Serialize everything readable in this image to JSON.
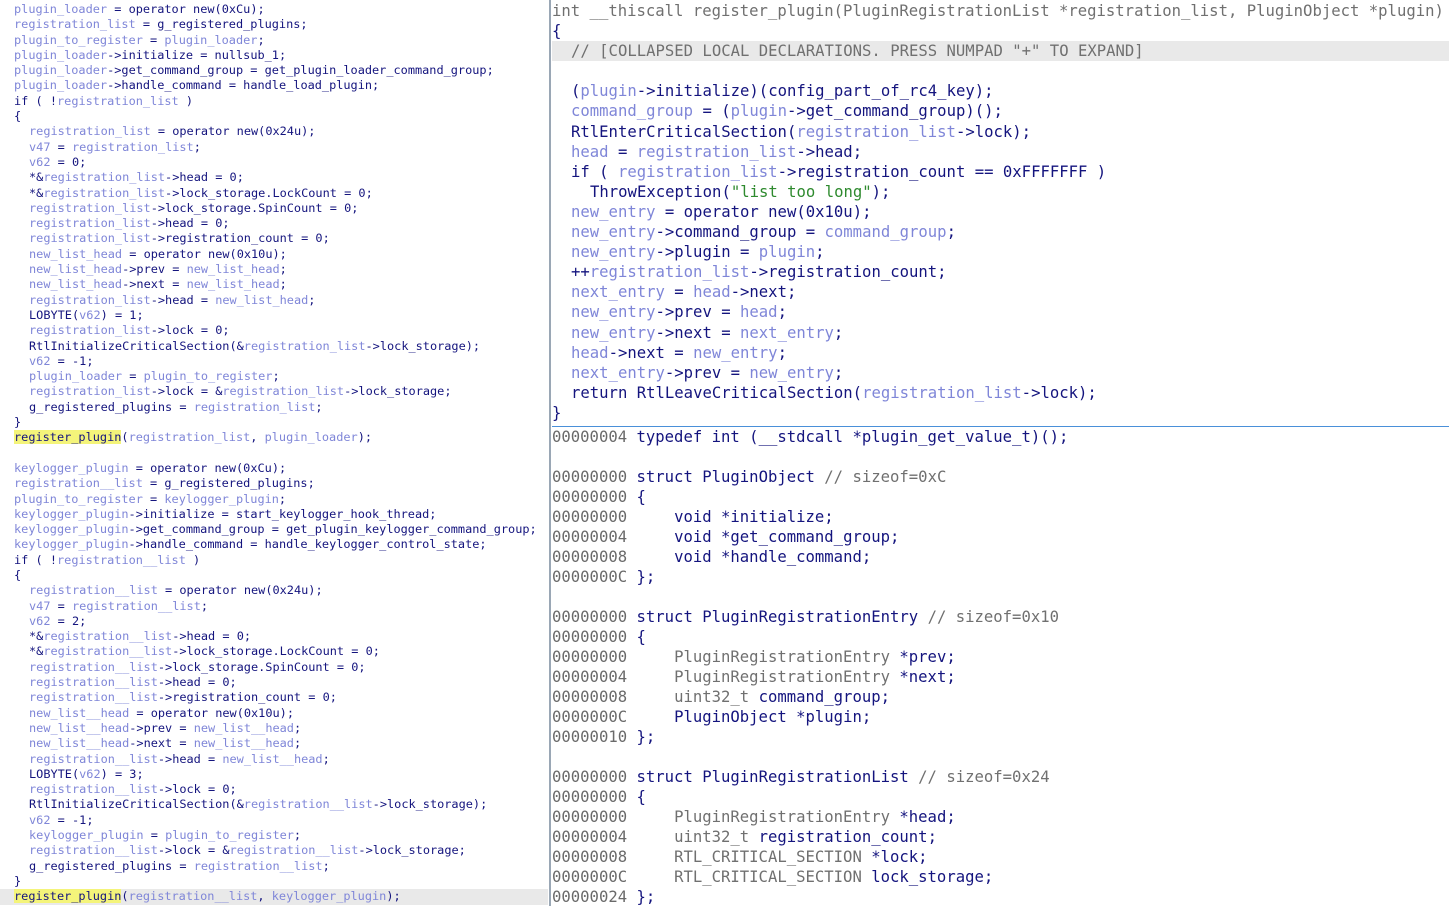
{
  "left_code": [
    {
      "t": "plugin_loader = operator new(0xCu);",
      "ind": false,
      "hl": false
    },
    {
      "t": "registration_list = g_registered_plugins;",
      "ind": false,
      "hl": false
    },
    {
      "t": "plugin_to_register = plugin_loader;",
      "ind": false,
      "hl": false
    },
    {
      "t": "plugin_loader->initialize = nullsub_1;",
      "ind": false,
      "hl": false
    },
    {
      "t": "plugin_loader->get_command_group = get_plugin_loader_command_group;",
      "ind": false,
      "hl": false
    },
    {
      "t": "plugin_loader->handle_command = handle_load_plugin;",
      "ind": false,
      "hl": false
    },
    {
      "t": "if ( !registration_list )",
      "ind": false,
      "hl": false
    },
    {
      "t": "{",
      "ind": false,
      "hl": false
    },
    {
      "t": "registration_list = operator new(0x24u);",
      "ind": true,
      "hl": false
    },
    {
      "t": "v47 = registration_list;",
      "ind": true,
      "hl": false
    },
    {
      "t": "v62 = 0;",
      "ind": true,
      "hl": false
    },
    {
      "t": "*&registration_list->head = 0;",
      "ind": true,
      "hl": false
    },
    {
      "t": "*&registration_list->lock_storage.LockCount = 0;",
      "ind": true,
      "hl": false
    },
    {
      "t": "registration_list->lock_storage.SpinCount = 0;",
      "ind": true,
      "hl": false
    },
    {
      "t": "registration_list->head = 0;",
      "ind": true,
      "hl": false
    },
    {
      "t": "registration_list->registration_count = 0;",
      "ind": true,
      "hl": false
    },
    {
      "t": "new_list_head = operator new(0x10u);",
      "ind": true,
      "hl": false
    },
    {
      "t": "new_list_head->prev = new_list_head;",
      "ind": true,
      "hl": false
    },
    {
      "t": "new_list_head->next = new_list_head;",
      "ind": true,
      "hl": false
    },
    {
      "t": "registration_list->head = new_list_head;",
      "ind": true,
      "hl": false
    },
    {
      "t": "LOBYTE(v62) = 1;",
      "ind": true,
      "hl": false
    },
    {
      "t": "registration_list->lock = 0;",
      "ind": true,
      "hl": false
    },
    {
      "t": "RtlInitializeCriticalSection(&registration_list->lock_storage);",
      "ind": true,
      "hl": false
    },
    {
      "t": "v62 = -1;",
      "ind": true,
      "hl": false
    },
    {
      "t": "plugin_loader = plugin_to_register;",
      "ind": true,
      "hl": false
    },
    {
      "t": "registration_list->lock = &registration_list->lock_storage;",
      "ind": true,
      "hl": false
    },
    {
      "t": "g_registered_plugins = registration_list;",
      "ind": true,
      "hl": false
    },
    {
      "t": "}",
      "ind": false,
      "hl": false
    },
    {
      "t": "register_plugin(registration_list, plugin_loader);",
      "ind": false,
      "hl": false,
      "sel": "register_plugin"
    },
    {
      "t": "",
      "ind": false,
      "hl": false
    },
    {
      "t": "keylogger_plugin = operator new(0xCu);",
      "ind": false,
      "hl": false
    },
    {
      "t": "registration__list = g_registered_plugins;",
      "ind": false,
      "hl": false
    },
    {
      "t": "plugin_to_register = keylogger_plugin;",
      "ind": false,
      "hl": false
    },
    {
      "t": "keylogger_plugin->initialize = start_keylogger_hook_thread;",
      "ind": false,
      "hl": false
    },
    {
      "t": "keylogger_plugin->get_command_group = get_plugin_keylogger_command_group;",
      "ind": false,
      "hl": false
    },
    {
      "t": "keylogger_plugin->handle_command = handle_keylogger_control_state;",
      "ind": false,
      "hl": false
    },
    {
      "t": "if ( !registration__list )",
      "ind": false,
      "hl": false
    },
    {
      "t": "{",
      "ind": false,
      "hl": false
    },
    {
      "t": "registration__list = operator new(0x24u);",
      "ind": true,
      "hl": false
    },
    {
      "t": "v47 = registration__list;",
      "ind": true,
      "hl": false
    },
    {
      "t": "v62 = 2;",
      "ind": true,
      "hl": false
    },
    {
      "t": "*&registration__list->head = 0;",
      "ind": true,
      "hl": false
    },
    {
      "t": "*&registration__list->lock_storage.LockCount = 0;",
      "ind": true,
      "hl": false
    },
    {
      "t": "registration__list->lock_storage.SpinCount = 0;",
      "ind": true,
      "hl": false
    },
    {
      "t": "registration__list->head = 0;",
      "ind": true,
      "hl": false
    },
    {
      "t": "registration__list->registration_count = 0;",
      "ind": true,
      "hl": false
    },
    {
      "t": "new_list__head = operator new(0x10u);",
      "ind": true,
      "hl": false
    },
    {
      "t": "new_list__head->prev = new_list__head;",
      "ind": true,
      "hl": false
    },
    {
      "t": "new_list__head->next = new_list__head;",
      "ind": true,
      "hl": false
    },
    {
      "t": "registration__list->head = new_list__head;",
      "ind": true,
      "hl": false
    },
    {
      "t": "LOBYTE(v62) = 3;",
      "ind": true,
      "hl": false
    },
    {
      "t": "registration__list->lock = 0;",
      "ind": true,
      "hl": false
    },
    {
      "t": "RtlInitializeCriticalSection(&registration__list->lock_storage);",
      "ind": true,
      "hl": false
    },
    {
      "t": "v62 = -1;",
      "ind": true,
      "hl": false
    },
    {
      "t": "keylogger_plugin = plugin_to_register;",
      "ind": true,
      "hl": false
    },
    {
      "t": "registration__list->lock = &registration__list->lock_storage;",
      "ind": true,
      "hl": false
    },
    {
      "t": "g_registered_plugins = registration__list;",
      "ind": true,
      "hl": false
    },
    {
      "t": "}",
      "ind": false,
      "hl": false
    },
    {
      "t": "register_plugin(registration__list, keylogger_plugin);",
      "ind": false,
      "hl": true,
      "sel": "register_plugin"
    }
  ],
  "right_top_code": [
    {
      "t": "int __thiscall register_plugin(PluginRegistrationList *registration_list, PluginObject *plugin)",
      "cls": "l0"
    },
    {
      "t": "{",
      "cls": "l0"
    },
    {
      "t": "// [COLLAPSED LOCAL DECLARATIONS. PRESS NUMPAD \"+\" TO EXPAND]",
      "cls": "cmtline"
    },
    {
      "t": "",
      "cls": ""
    },
    {
      "t": "(plugin->initialize)(config_part_of_rc4_key);",
      "cls": ""
    },
    {
      "t": "command_group = (plugin->get_command_group)();",
      "cls": ""
    },
    {
      "t": "RtlEnterCriticalSection(registration_list->lock);",
      "cls": ""
    },
    {
      "t": "head = registration_list->head;",
      "cls": ""
    },
    {
      "t": "if ( registration_list->registration_count == 0xFFFFFFF )",
      "cls": ""
    },
    {
      "t": "ThrowException(\"list too long\");",
      "cls": "ind2"
    },
    {
      "t": "new_entry = operator new(0x10u);",
      "cls": ""
    },
    {
      "t": "new_entry->command_group = command_group;",
      "cls": ""
    },
    {
      "t": "new_entry->plugin = plugin;",
      "cls": ""
    },
    {
      "t": "++registration_list->registration_count;",
      "cls": ""
    },
    {
      "t": "next_entry = head->next;",
      "cls": ""
    },
    {
      "t": "new_entry->prev = head;",
      "cls": ""
    },
    {
      "t": "new_entry->next = next_entry;",
      "cls": ""
    },
    {
      "t": "head->next = new_entry;",
      "cls": ""
    },
    {
      "t": "next_entry->prev = new_entry;",
      "cls": ""
    },
    {
      "t": "return RtlLeaveCriticalSection(registration_list->lock);",
      "cls": ""
    },
    {
      "t": "}",
      "cls": "l0"
    }
  ],
  "right_bottom_code": [
    {
      "a": "00000004",
      "t": " typedef int (__stdcall *plugin_get_value_t)();"
    },
    {
      "a": "",
      "t": ""
    },
    {
      "a": "00000000",
      "t": " struct PluginObject // sizeof=0xC"
    },
    {
      "a": "00000000",
      "t": " {"
    },
    {
      "a": "00000000",
      "t": "     void *initialize;"
    },
    {
      "a": "00000004",
      "t": "     void *get_command_group;"
    },
    {
      "a": "00000008",
      "t": "     void *handle_command;"
    },
    {
      "a": "0000000C",
      "t": " };"
    },
    {
      "a": "",
      "t": ""
    },
    {
      "a": "00000000",
      "t": " struct PluginRegistrationEntry // sizeof=0x10"
    },
    {
      "a": "00000000",
      "t": " {"
    },
    {
      "a": "00000000",
      "t": "     PluginRegistrationEntry *prev;"
    },
    {
      "a": "00000004",
      "t": "     PluginRegistrationEntry *next;"
    },
    {
      "a": "00000008",
      "t": "     uint32_t command_group;"
    },
    {
      "a": "0000000C",
      "t": "     PluginObject *plugin;"
    },
    {
      "a": "00000010",
      "t": " };"
    },
    {
      "a": "",
      "t": ""
    },
    {
      "a": "00000000",
      "t": " struct PluginRegistrationList // sizeof=0x24"
    },
    {
      "a": "00000000",
      "t": " {"
    },
    {
      "a": "00000000",
      "t": "     PluginRegistrationEntry *head;"
    },
    {
      "a": "00000004",
      "t": "     uint32_t registration_count;"
    },
    {
      "a": "00000008",
      "t": "     RTL_CRITICAL_SECTION *lock;"
    },
    {
      "a": "0000000C",
      "t": "     RTL_CRITICAL_SECTION lock_storage;"
    },
    {
      "a": "00000024",
      "t": " };"
    }
  ],
  "colors": {
    "variable": "#7f86d8",
    "keyword": "#14147e",
    "string": "#2e8a2e",
    "comment": "#707070",
    "highlight": "#f4f47a",
    "current_line": "#e9e9e9"
  }
}
